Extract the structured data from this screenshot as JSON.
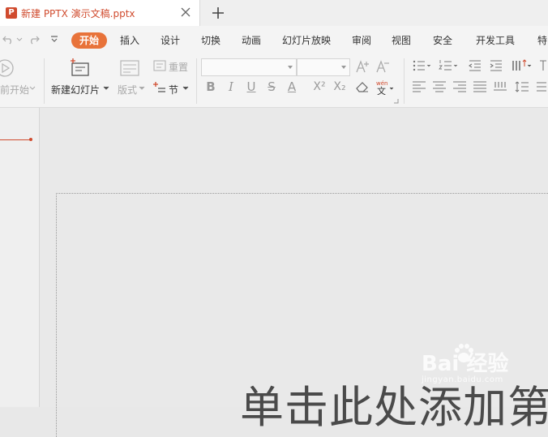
{
  "tab": {
    "title": "新建 PPTX 演示文稿.pptx",
    "icon_letter": "P"
  },
  "menu": {
    "items": [
      "开始",
      "插入",
      "设计",
      "切换",
      "动画",
      "幻灯片放映",
      "审阅",
      "视图",
      "安全",
      "开发工具",
      "特"
    ],
    "active_index": 0
  },
  "ribbon": {
    "from_current": "前开始",
    "new_slide": "新建幻灯片",
    "layout": "版式",
    "reset": "重置",
    "section": "节",
    "font_name": "",
    "font_size": ""
  },
  "slide": {
    "title_placeholder": "单击此处添加第"
  },
  "watermark": {
    "main": "Bai 经验",
    "sub": "jingyan.baidu.com"
  },
  "colors": {
    "accent": "#d04b2e",
    "active_tab": "#e8733a"
  }
}
